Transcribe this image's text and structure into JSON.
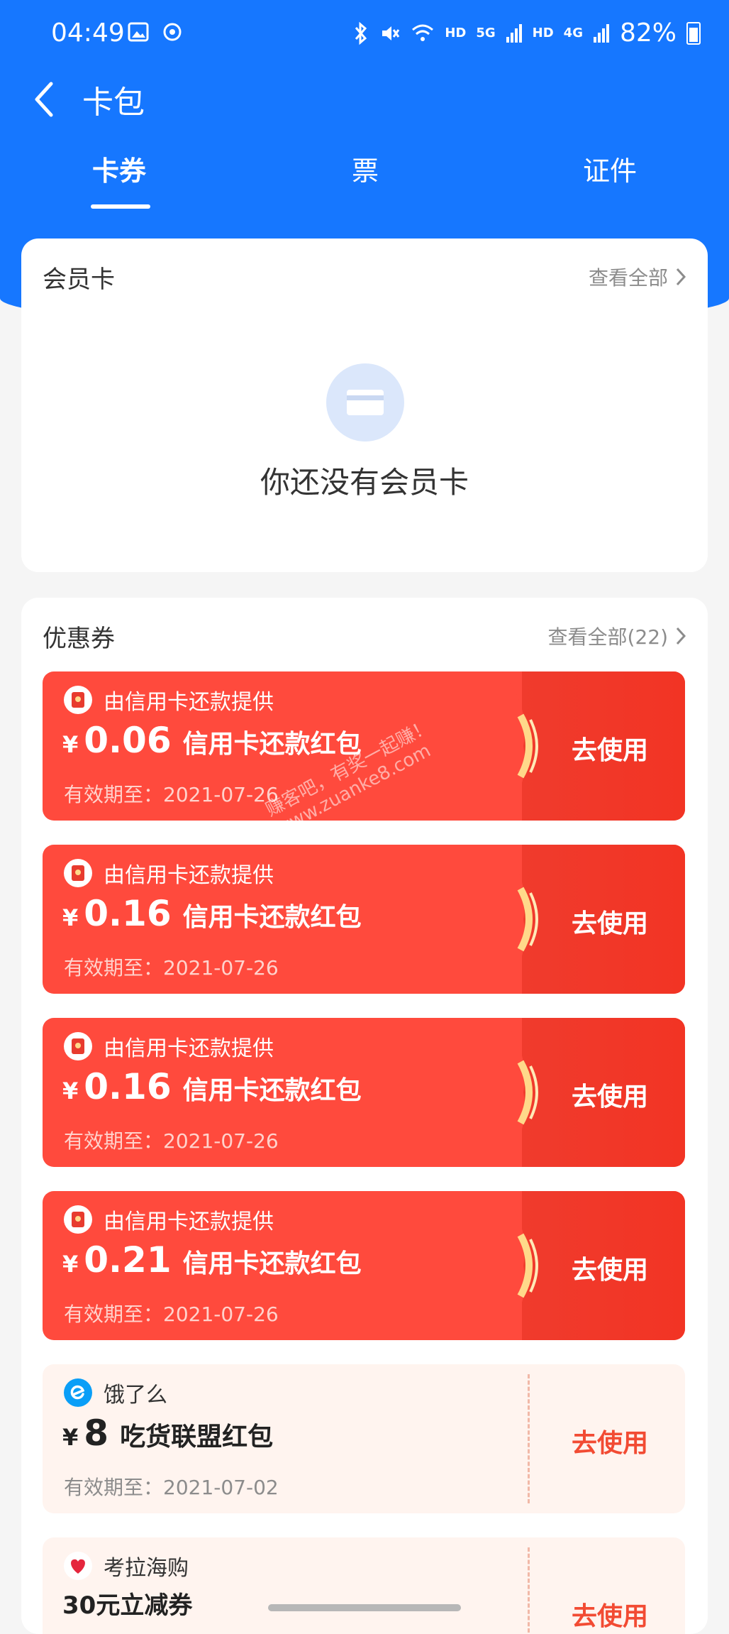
{
  "status": {
    "time": "04:49",
    "network_labels": [
      "HD",
      "5G",
      "HD",
      "4G"
    ],
    "battery": "82%"
  },
  "nav": {
    "title": "卡包",
    "back_icon": "chevron-left-icon"
  },
  "tabs": [
    {
      "label": "卡券",
      "active": true
    },
    {
      "label": "票",
      "active": false
    },
    {
      "label": "证件",
      "active": false
    }
  ],
  "membership": {
    "title": "会员卡",
    "see_all": "查看全部",
    "empty_icon": "card-icon",
    "empty_text": "你还没有会员卡"
  },
  "coupons_section": {
    "title": "优惠券",
    "see_all": "查看全部(22)",
    "items": [
      {
        "provider": "由信用卡还款提供",
        "currency": "¥",
        "amount": "0.06",
        "name": "信用卡还款红包",
        "expiry": "有效期至：2021-07-26",
        "action": "去使用",
        "style": "red"
      },
      {
        "provider": "由信用卡还款提供",
        "currency": "¥",
        "amount": "0.16",
        "name": "信用卡还款红包",
        "expiry": "有效期至：2021-07-26",
        "action": "去使用",
        "style": "red"
      },
      {
        "provider": "由信用卡还款提供",
        "currency": "¥",
        "amount": "0.16",
        "name": "信用卡还款红包",
        "expiry": "有效期至：2021-07-26",
        "action": "去使用",
        "style": "red"
      },
      {
        "provider": "由信用卡还款提供",
        "currency": "¥",
        "amount": "0.21",
        "name": "信用卡还款红包",
        "expiry": "有效期至：2021-07-26",
        "action": "去使用",
        "style": "red"
      },
      {
        "provider": "饿了么",
        "currency": "¥",
        "amount": "8",
        "name": "吃货联盟红包",
        "expiry": "有效期至：2021-07-02",
        "action": "去使用",
        "style": "light"
      },
      {
        "provider": "考拉海购",
        "currency": "",
        "amount": "30元立减券",
        "name": "",
        "expiry": "",
        "action": "去使用",
        "style": "light"
      }
    ]
  },
  "watermark": [
    "赚客吧，有奖一起赚！",
    "www.zuanke8.com"
  ],
  "colors": {
    "brand_blue": "#1677ff",
    "coupon_red": "#ff4a3d",
    "coupon_light": "#fff4ef",
    "action_red": "#f24b33"
  }
}
